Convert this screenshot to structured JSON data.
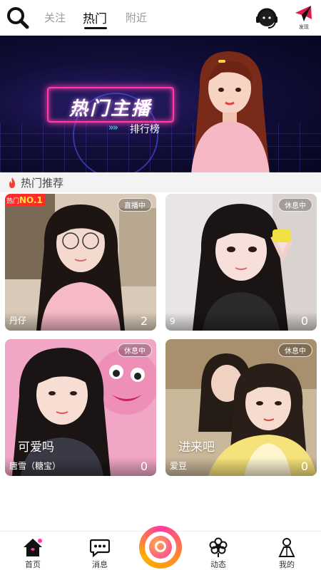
{
  "header": {
    "tabs": [
      {
        "label": "关注",
        "active": false
      },
      {
        "label": "热门",
        "active": true
      },
      {
        "label": "附近",
        "active": false
      }
    ],
    "discover_label": "发现",
    "icons": {
      "search": "search-icon",
      "service": "headset-icon",
      "discover": "paper-plane-icon"
    }
  },
  "banner": {
    "title": "热门主播",
    "subtitle": "排行榜",
    "arrows": "»»",
    "slides_total": 4,
    "active_slide": 0
  },
  "section": {
    "title": "热门推荐",
    "icon": "flame-icon"
  },
  "hot_badge": {
    "label": "热门",
    "number": "NO.1"
  },
  "cards": [
    {
      "status": "直播中",
      "name": "丹仔",
      "count": "2",
      "caption": ""
    },
    {
      "status": "休息中",
      "name": "9",
      "count": "0",
      "caption": ""
    },
    {
      "status": "休息中",
      "name": "唐雪（糖宝）",
      "count": "0",
      "caption": "可爱吗"
    },
    {
      "status": "休息中",
      "name": "爱豆",
      "count": "0",
      "caption": "进来吧"
    }
  ],
  "nav": {
    "items": [
      {
        "label": "首页",
        "icon": "home-icon"
      },
      {
        "label": "消息",
        "icon": "message-icon"
      },
      {
        "label": "动态",
        "icon": "flower-icon"
      },
      {
        "label": "我的",
        "icon": "person-icon"
      }
    ],
    "center_icon": "live-camera-icon"
  },
  "colors": {
    "accent_pink": "#ff3aa3",
    "banner_bg": "#120e3a",
    "hot_red": "#ff2b2b"
  }
}
